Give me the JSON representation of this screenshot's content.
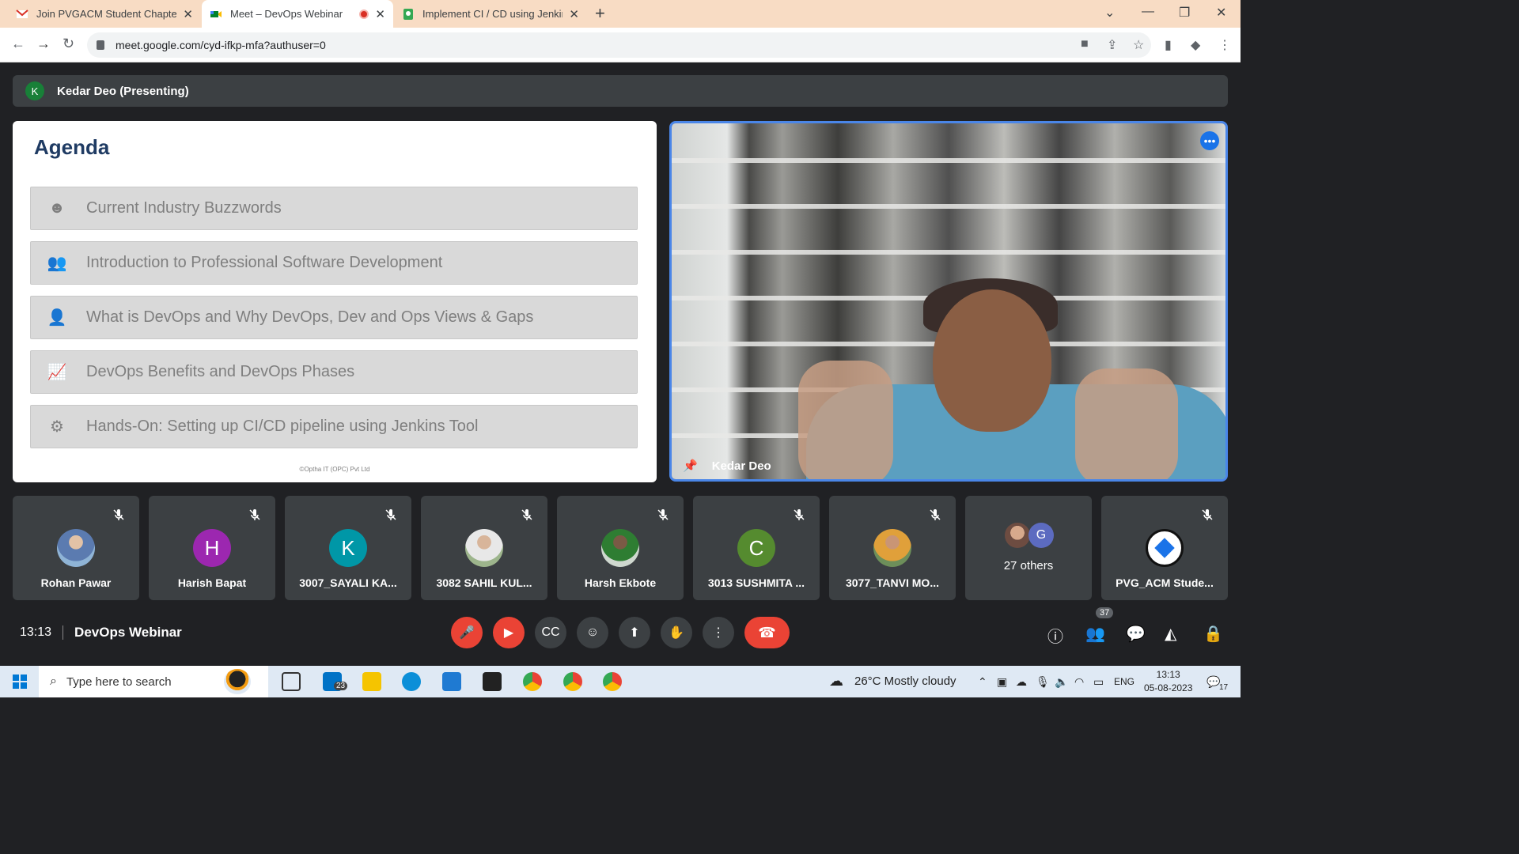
{
  "browser": {
    "tabs": [
      {
        "title": "Join PVGACM Student Chapter W",
        "active": false,
        "icon": "gmail-icon"
      },
      {
        "title": "Meet – DevOps Webinar",
        "active": true,
        "icon": "meet-icon"
      },
      {
        "title": "Implement CI / CD using Jenkins",
        "active": false,
        "icon": "site-icon"
      }
    ],
    "url": "meet.google.com/cyd-ifkp-mfa?authuser=0"
  },
  "meeting": {
    "presenter_initial": "K",
    "presenter_label": "Kedar Deo (Presenting)",
    "time": "13:13",
    "title": "DevOps Webinar",
    "participant_count": "37"
  },
  "slide": {
    "title": "Agenda",
    "items": [
      {
        "icon": "head-gear-icon",
        "text": "Current Industry Buzzwords"
      },
      {
        "icon": "group-icon",
        "text": "Introduction to Professional Software Development"
      },
      {
        "icon": "person-icon",
        "text": "What is DevOps and Why DevOps, Dev and Ops Views & Gaps"
      },
      {
        "icon": "line-chart-icon",
        "text": "DevOps Benefits and DevOps Phases"
      },
      {
        "icon": "gears-icon",
        "text": "Hands-On: Setting up CI/CD pipeline using Jenkins Tool"
      }
    ],
    "footer": "©Optha IT (OPC) Pvt Ltd"
  },
  "main_video": {
    "name": "Kedar Deo"
  },
  "participants": [
    {
      "name": "Rohan Pawar",
      "initial": "",
      "color": ""
    },
    {
      "name": "Harish Bapat",
      "initial": "H",
      "color": "#9c27b0"
    },
    {
      "name": "3007_SAYALI KA...",
      "initial": "K",
      "color": "#0097a7"
    },
    {
      "name": "3082 SAHIL KUL...",
      "initial": "",
      "color": ""
    },
    {
      "name": "Harsh Ekbote",
      "initial": "",
      "color": ""
    },
    {
      "name": "3013 SUSHMITA ...",
      "initial": "C",
      "color": "#558b2f"
    },
    {
      "name": "3077_TANVI MO...",
      "initial": "",
      "color": ""
    },
    {
      "name": "27 others",
      "initial": "G",
      "color": "#5c6bc0"
    },
    {
      "name": "PVG_ACM Stude...",
      "initial": "",
      "color": ""
    }
  ],
  "taskbar": {
    "search_placeholder": "Type here to search",
    "mail_badge": "23",
    "weather": "26°C  Mostly cloudy",
    "lang": "ENG",
    "time": "13:13",
    "date": "05-08-2023",
    "notif": "17"
  }
}
